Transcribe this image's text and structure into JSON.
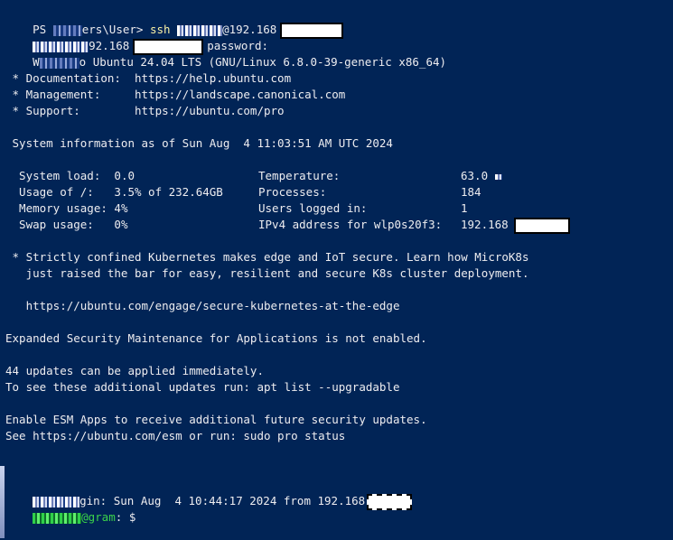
{
  "prompt": {
    "ps": "PS ",
    "path": "ers\\User> ",
    "cmd": "ssh ",
    "host": "@192.168"
  },
  "password_line": {
    "ip": "92.168",
    "suffix": "password:"
  },
  "welcome": {
    "prefix": "W",
    "text": "o Ubuntu 24.04 LTS (GNU/Linux 6.8.0-39-generic x86_64)"
  },
  "links": [
    {
      "label": " * Documentation:  ",
      "url": "https://help.ubuntu.com"
    },
    {
      "label": " * Management:     ",
      "url": "https://landscape.canonical.com"
    },
    {
      "label": " * Support:        ",
      "url": "https://ubuntu.com/pro"
    }
  ],
  "sysinfo_header": " System information as of Sun Aug  4 11:03:51 AM UTC 2024",
  "sysinfo": [
    {
      "k1": "  System load:  ",
      "v1": "0.0",
      "k2": "Temperature:",
      "v2": "63.0 "
    },
    {
      "k1": "  Usage of /:   ",
      "v1": "3.5% of 232.64GB",
      "k2": "Processes:",
      "v2": "184"
    },
    {
      "k1": "  Memory usage: ",
      "v1": "4%",
      "k2": "Users logged in:",
      "v2": "1"
    },
    {
      "k1": "  Swap usage:   ",
      "v1": "0%",
      "k2": "IPv4 address for wlp0s20f3:",
      "v2": "192.168"
    }
  ],
  "k8s": [
    " * Strictly confined Kubernetes makes edge and IoT secure. Learn how MicroK8s",
    "   just raised the bar for easy, resilient and secure K8s cluster deployment.",
    "",
    "   https://ubuntu.com/engage/secure-kubernetes-at-the-edge"
  ],
  "esm_status": "Expanded Security Maintenance for Applications is not enabled.",
  "updates": [
    "44 updates can be applied immediately.",
    "To see these additional updates run: apt list --upgradable"
  ],
  "esm_apps": [
    "Enable ESM Apps to receive additional future security updates.",
    "See https://ubuntu.com/esm or run: sudo pro status"
  ],
  "last_login": {
    "text": "gin: Sun Aug  4 10:44:17 2024 from 192.168"
  },
  "shell_prompt": {
    "host": "@gram",
    "sep": ": ",
    "sym": "$"
  },
  "colors": {
    "background": "#012456",
    "text": "#eeedf0",
    "command": "#f9f1a5",
    "user": "#3bd34a"
  }
}
